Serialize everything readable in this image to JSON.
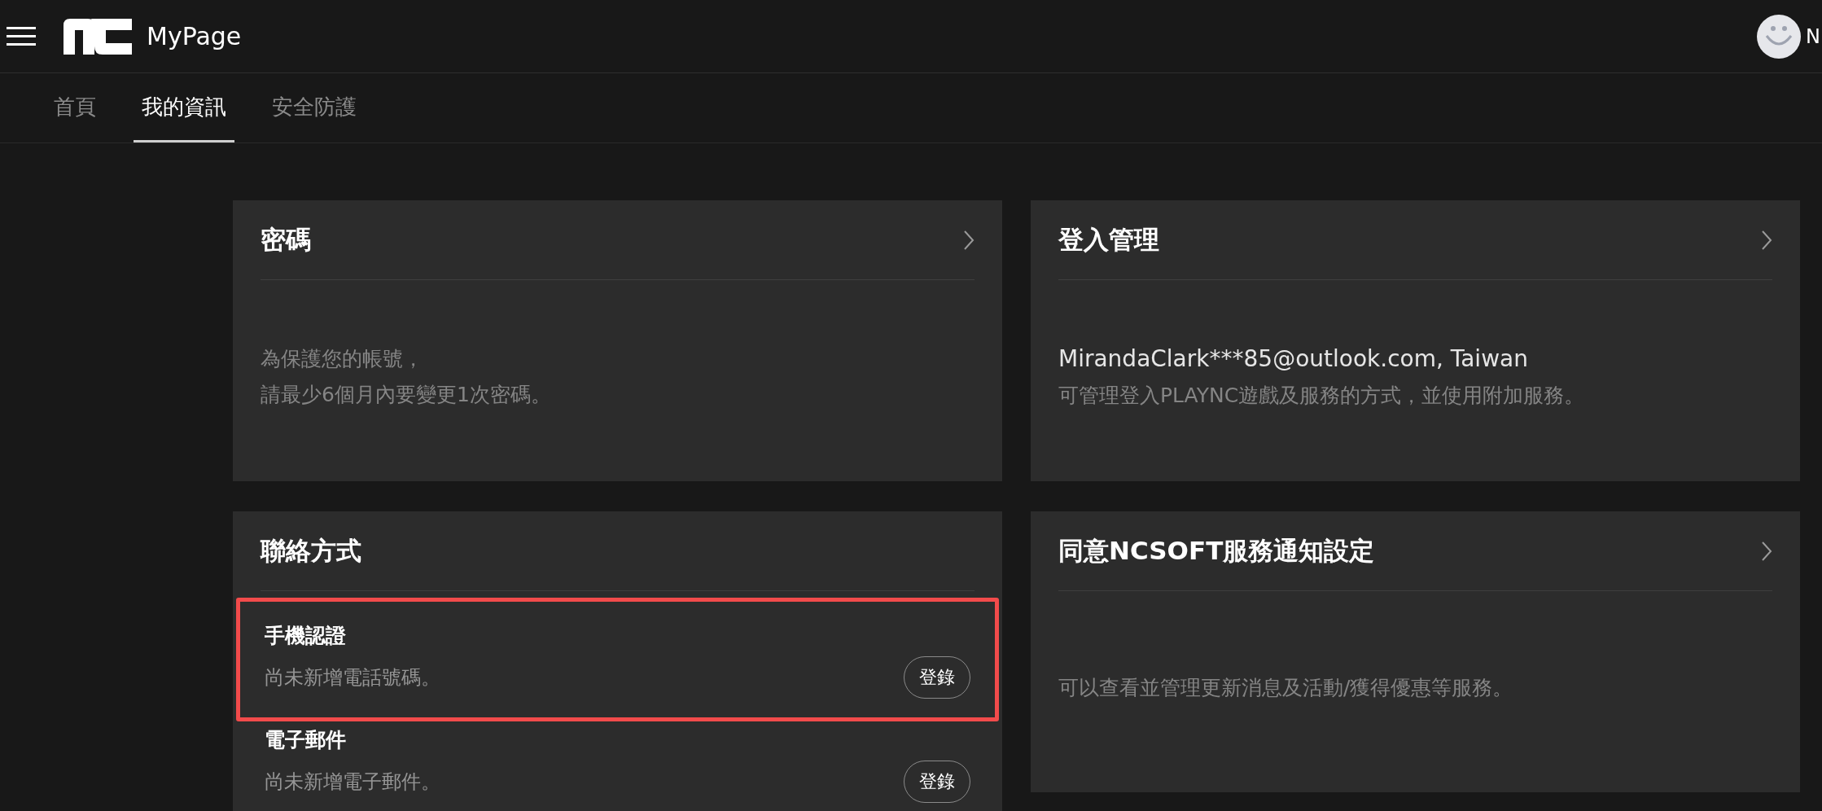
{
  "header": {
    "title": "MyPage",
    "user_name": "N"
  },
  "tabs": [
    {
      "label": "首頁",
      "selected": false
    },
    {
      "label": "我的資訊",
      "selected": true
    },
    {
      "label": "安全防護",
      "selected": false
    }
  ],
  "cards": [
    {
      "kind": "text",
      "title": "密碼",
      "chevron": true,
      "lines": [
        {
          "text": "為保護您的帳號，",
          "emphasis": false
        },
        {
          "text": "請最少6個月內要變更1次密碼。",
          "emphasis": false
        }
      ]
    },
    {
      "kind": "text",
      "title": "登入管理",
      "chevron": true,
      "lines": [
        {
          "text": "MirandaClark***85@outlook.com, Taiwan",
          "emphasis": true
        },
        {
          "text": "可管理登入PLAYNC遊戲及服務的方式，並使用附加服務。",
          "emphasis": false
        }
      ]
    },
    {
      "kind": "contacts",
      "title": "聯絡方式",
      "chevron": false,
      "items": [
        {
          "label": "手機認證",
          "status": "尚未新增電話號碼。",
          "button": "登錄",
          "highlighted": true
        },
        {
          "label": "電子郵件",
          "status": "尚未新增電子郵件。",
          "button": "登錄",
          "highlighted": false
        }
      ]
    },
    {
      "kind": "text",
      "title": "同意NCSOFT服務通知設定",
      "chevron": true,
      "lines": [
        {
          "text": "可以查看並管理更新消息及活動/獲得優惠等服務。",
          "emphasis": false
        }
      ]
    }
  ]
}
